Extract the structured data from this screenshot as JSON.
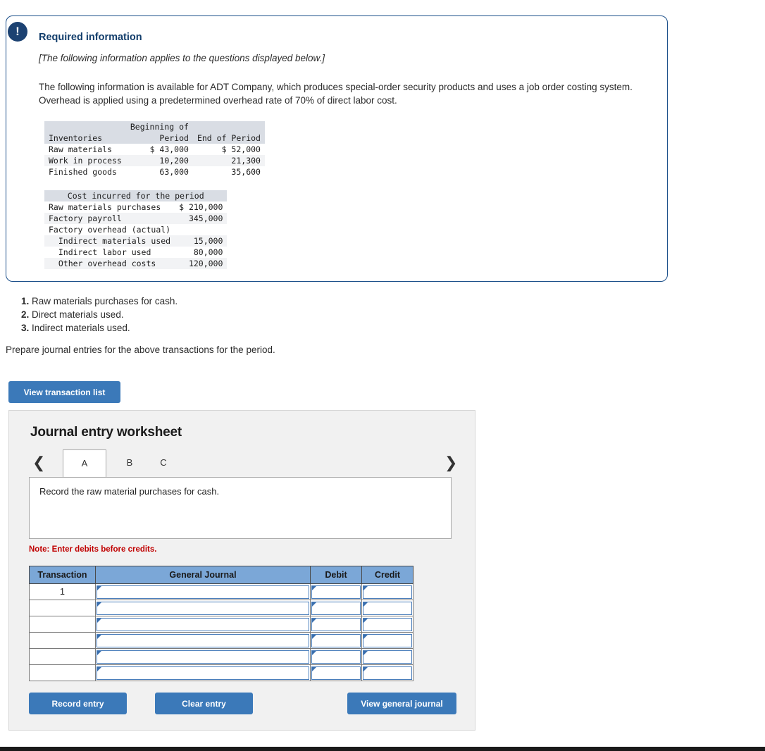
{
  "required_info": {
    "alert_icon": "exclamation-icon",
    "title": "Required information",
    "subtitle": "[The following information applies to the questions displayed below.]",
    "paragraph": "The following information is available for ADT Company, which produces special-order security products and uses a job order costing system. Overhead is applied using a predetermined overhead rate of 70% of direct labor cost.",
    "inventories_table": {
      "header_line1": "Beginning of",
      "col_label": "Inventories",
      "col_beginning": "Period",
      "col_end": "End of Period",
      "rows": [
        {
          "label": "Raw materials",
          "beginning": "$ 43,000",
          "end": "$ 52,000"
        },
        {
          "label": "Work in process",
          "beginning": "10,200",
          "end": "21,300"
        },
        {
          "label": "Finished goods",
          "beginning": "63,000",
          "end": "35,600"
        }
      ]
    },
    "cost_table": {
      "title": "Cost incurred for the period",
      "rows": [
        {
          "label": "Raw materials purchases",
          "amount": "$ 210,000"
        },
        {
          "label": "Factory payroll",
          "amount": "345,000"
        },
        {
          "label": "Factory overhead (actual)",
          "amount": ""
        },
        {
          "label": "  Indirect materials used",
          "amount": "15,000"
        },
        {
          "label": "  Indirect labor used",
          "amount": "80,000"
        },
        {
          "label": "  Other overhead costs",
          "amount": "120,000"
        }
      ]
    }
  },
  "questions": [
    {
      "num": "1.",
      "text": "Raw materials purchases for cash."
    },
    {
      "num": "2.",
      "text": "Direct materials used."
    },
    {
      "num": "3.",
      "text": "Indirect materials used."
    }
  ],
  "prepare_line": "Prepare journal entries for the above transactions for the period.",
  "view_transaction_list_label": "View transaction list",
  "worksheet": {
    "title": "Journal entry worksheet",
    "nav_prev_icon": "chevron-left-icon",
    "nav_next_icon": "chevron-right-icon",
    "tabs": [
      {
        "label": "A",
        "active": true
      },
      {
        "label": "B",
        "active": false
      },
      {
        "label": "C",
        "active": false
      }
    ],
    "prompt": "Record the raw material purchases for cash.",
    "note": "Note: Enter debits before credits.",
    "columns": [
      "Transaction",
      "General Journal",
      "Debit",
      "Credit"
    ],
    "rows": [
      {
        "transaction": "1",
        "general_journal": "",
        "debit": "",
        "credit": ""
      },
      {
        "transaction": "",
        "general_journal": "",
        "debit": "",
        "credit": ""
      },
      {
        "transaction": "",
        "general_journal": "",
        "debit": "",
        "credit": ""
      },
      {
        "transaction": "",
        "general_journal": "",
        "debit": "",
        "credit": ""
      },
      {
        "transaction": "",
        "general_journal": "",
        "debit": "",
        "credit": ""
      },
      {
        "transaction": "",
        "general_journal": "",
        "debit": "",
        "credit": ""
      }
    ],
    "record_entry_label": "Record entry",
    "clear_entry_label": "Clear entry",
    "view_general_journal_label": "View general journal"
  },
  "colors": {
    "card_border": "#1b4f8a",
    "heading": "#123d6b",
    "button_blue": "#3b79b9",
    "table_header_blue": "#7ba7d7",
    "note_red": "#c00000",
    "panel_bg": "#f1f1f1",
    "mono_header_bg": "#d9dde4"
  }
}
